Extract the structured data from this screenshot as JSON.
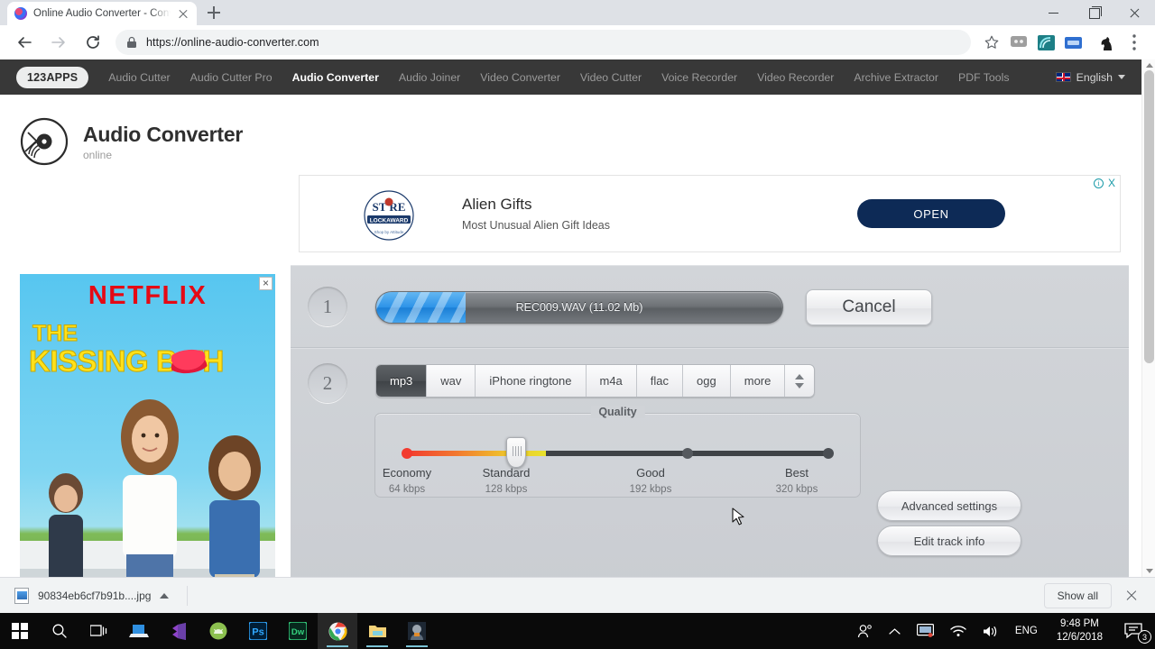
{
  "browser": {
    "tab": {
      "title": "Online Audio Converter - Conver",
      "favicon": "audio-converter-favicon"
    },
    "new_tab_label": "+",
    "url": "https://online-audio-converter.com",
    "omnibox_lock": "lock-icon",
    "toolbar_icons": [
      "back-icon",
      "forward-icon",
      "reload-icon",
      "bookmark-star-icon",
      "extension-grey-icon",
      "extension-teal-icon",
      "extension-blue-icon",
      "extension-knight-icon",
      "chrome-menu-icon"
    ],
    "window_controls": [
      "minimize",
      "maximize",
      "close"
    ]
  },
  "site_nav": {
    "brand": "123APPS",
    "links": [
      {
        "label": "Audio Cutter",
        "active": false
      },
      {
        "label": "Audio Cutter Pro",
        "active": false
      },
      {
        "label": "Audio Converter",
        "active": true
      },
      {
        "label": "Audio Joiner",
        "active": false
      },
      {
        "label": "Video Converter",
        "active": false
      },
      {
        "label": "Video Cutter",
        "active": false
      },
      {
        "label": "Voice Recorder",
        "active": false
      },
      {
        "label": "Video Recorder",
        "active": false
      },
      {
        "label": "Archive Extractor",
        "active": false
      },
      {
        "label": "PDF Tools",
        "active": false
      }
    ],
    "language": "English",
    "flag": "uk-flag-icon"
  },
  "app": {
    "title": "Audio Converter",
    "subtitle": "online",
    "logo": "vinyl-record-icon"
  },
  "top_ad": {
    "logo_line1": "ST RE",
    "logo_line2": "LOCKAWARD",
    "headline": "Alien Gifts",
    "subtext": "Most Unusual Alien Gift Ideas",
    "button_label": "OPEN",
    "info_glyph": "i",
    "close_glyph": "X",
    "button_color": "#0d2a56"
  },
  "side_ad": {
    "brand": "NETFLIX",
    "title_line1": "THE",
    "title_line2": "KISSING B   TH",
    "close_glyph": "×",
    "brand_color": "#e50914",
    "title_color": "#ffe11a"
  },
  "converter": {
    "step1": {
      "number": "1",
      "file_label": "REC009.WAV (11.02 Mb)",
      "progress_percent": 22,
      "cancel_label": "Cancel"
    },
    "step2": {
      "number": "2",
      "formats": [
        {
          "label": "mp3",
          "selected": true
        },
        {
          "label": "wav",
          "selected": false
        },
        {
          "label": "iPhone ringtone",
          "selected": false
        },
        {
          "label": "m4a",
          "selected": false
        },
        {
          "label": "flac",
          "selected": false
        },
        {
          "label": "ogg",
          "selected": false
        },
        {
          "label": "more",
          "selected": false
        }
      ],
      "quality": {
        "title": "Quality",
        "selected_index": 1,
        "stops": [
          {
            "name": "Economy",
            "rate": "64 kbps"
          },
          {
            "name": "Standard",
            "rate": "128 kbps"
          },
          {
            "name": "Good",
            "rate": "192 kbps"
          },
          {
            "name": "Best",
            "rate": "320 kbps"
          }
        ]
      },
      "advanced_settings_label": "Advanced settings",
      "edit_track_info_label": "Edit track info"
    }
  },
  "download_shelf": {
    "filename": "90834eb6cf7b91b....jpg",
    "show_all_label": "Show all"
  },
  "taskbar": {
    "items": [
      {
        "name": "start-button",
        "icon": "windows-logo-icon"
      },
      {
        "name": "search-button",
        "icon": "search-icon"
      },
      {
        "name": "task-view-button",
        "icon": "task-view-icon"
      },
      {
        "name": "remote-desktop-app",
        "icon": "laptop-icon"
      },
      {
        "name": "visual-studio-code-app",
        "icon": "vscode-icon"
      },
      {
        "name": "android-studio-app",
        "icon": "android-studio-icon"
      },
      {
        "name": "photoshop-app",
        "icon": "photoshop-icon"
      },
      {
        "name": "dreamweaver-app",
        "icon": "dreamweaver-icon"
      },
      {
        "name": "chrome-app",
        "icon": "chrome-icon"
      },
      {
        "name": "file-explorer-app",
        "icon": "folder-icon"
      },
      {
        "name": "game-app",
        "icon": "game-avatar-icon"
      }
    ],
    "tray": {
      "people_icon": "people-icon",
      "overflow_icon": "chevron-up-icon",
      "display_icon": "display-icon",
      "network_icon": "wifi-icon",
      "volume_icon": "speaker-icon",
      "language": "ENG",
      "time": "9:48 PM",
      "date": "12/6/2018",
      "notification_count": "3"
    }
  }
}
